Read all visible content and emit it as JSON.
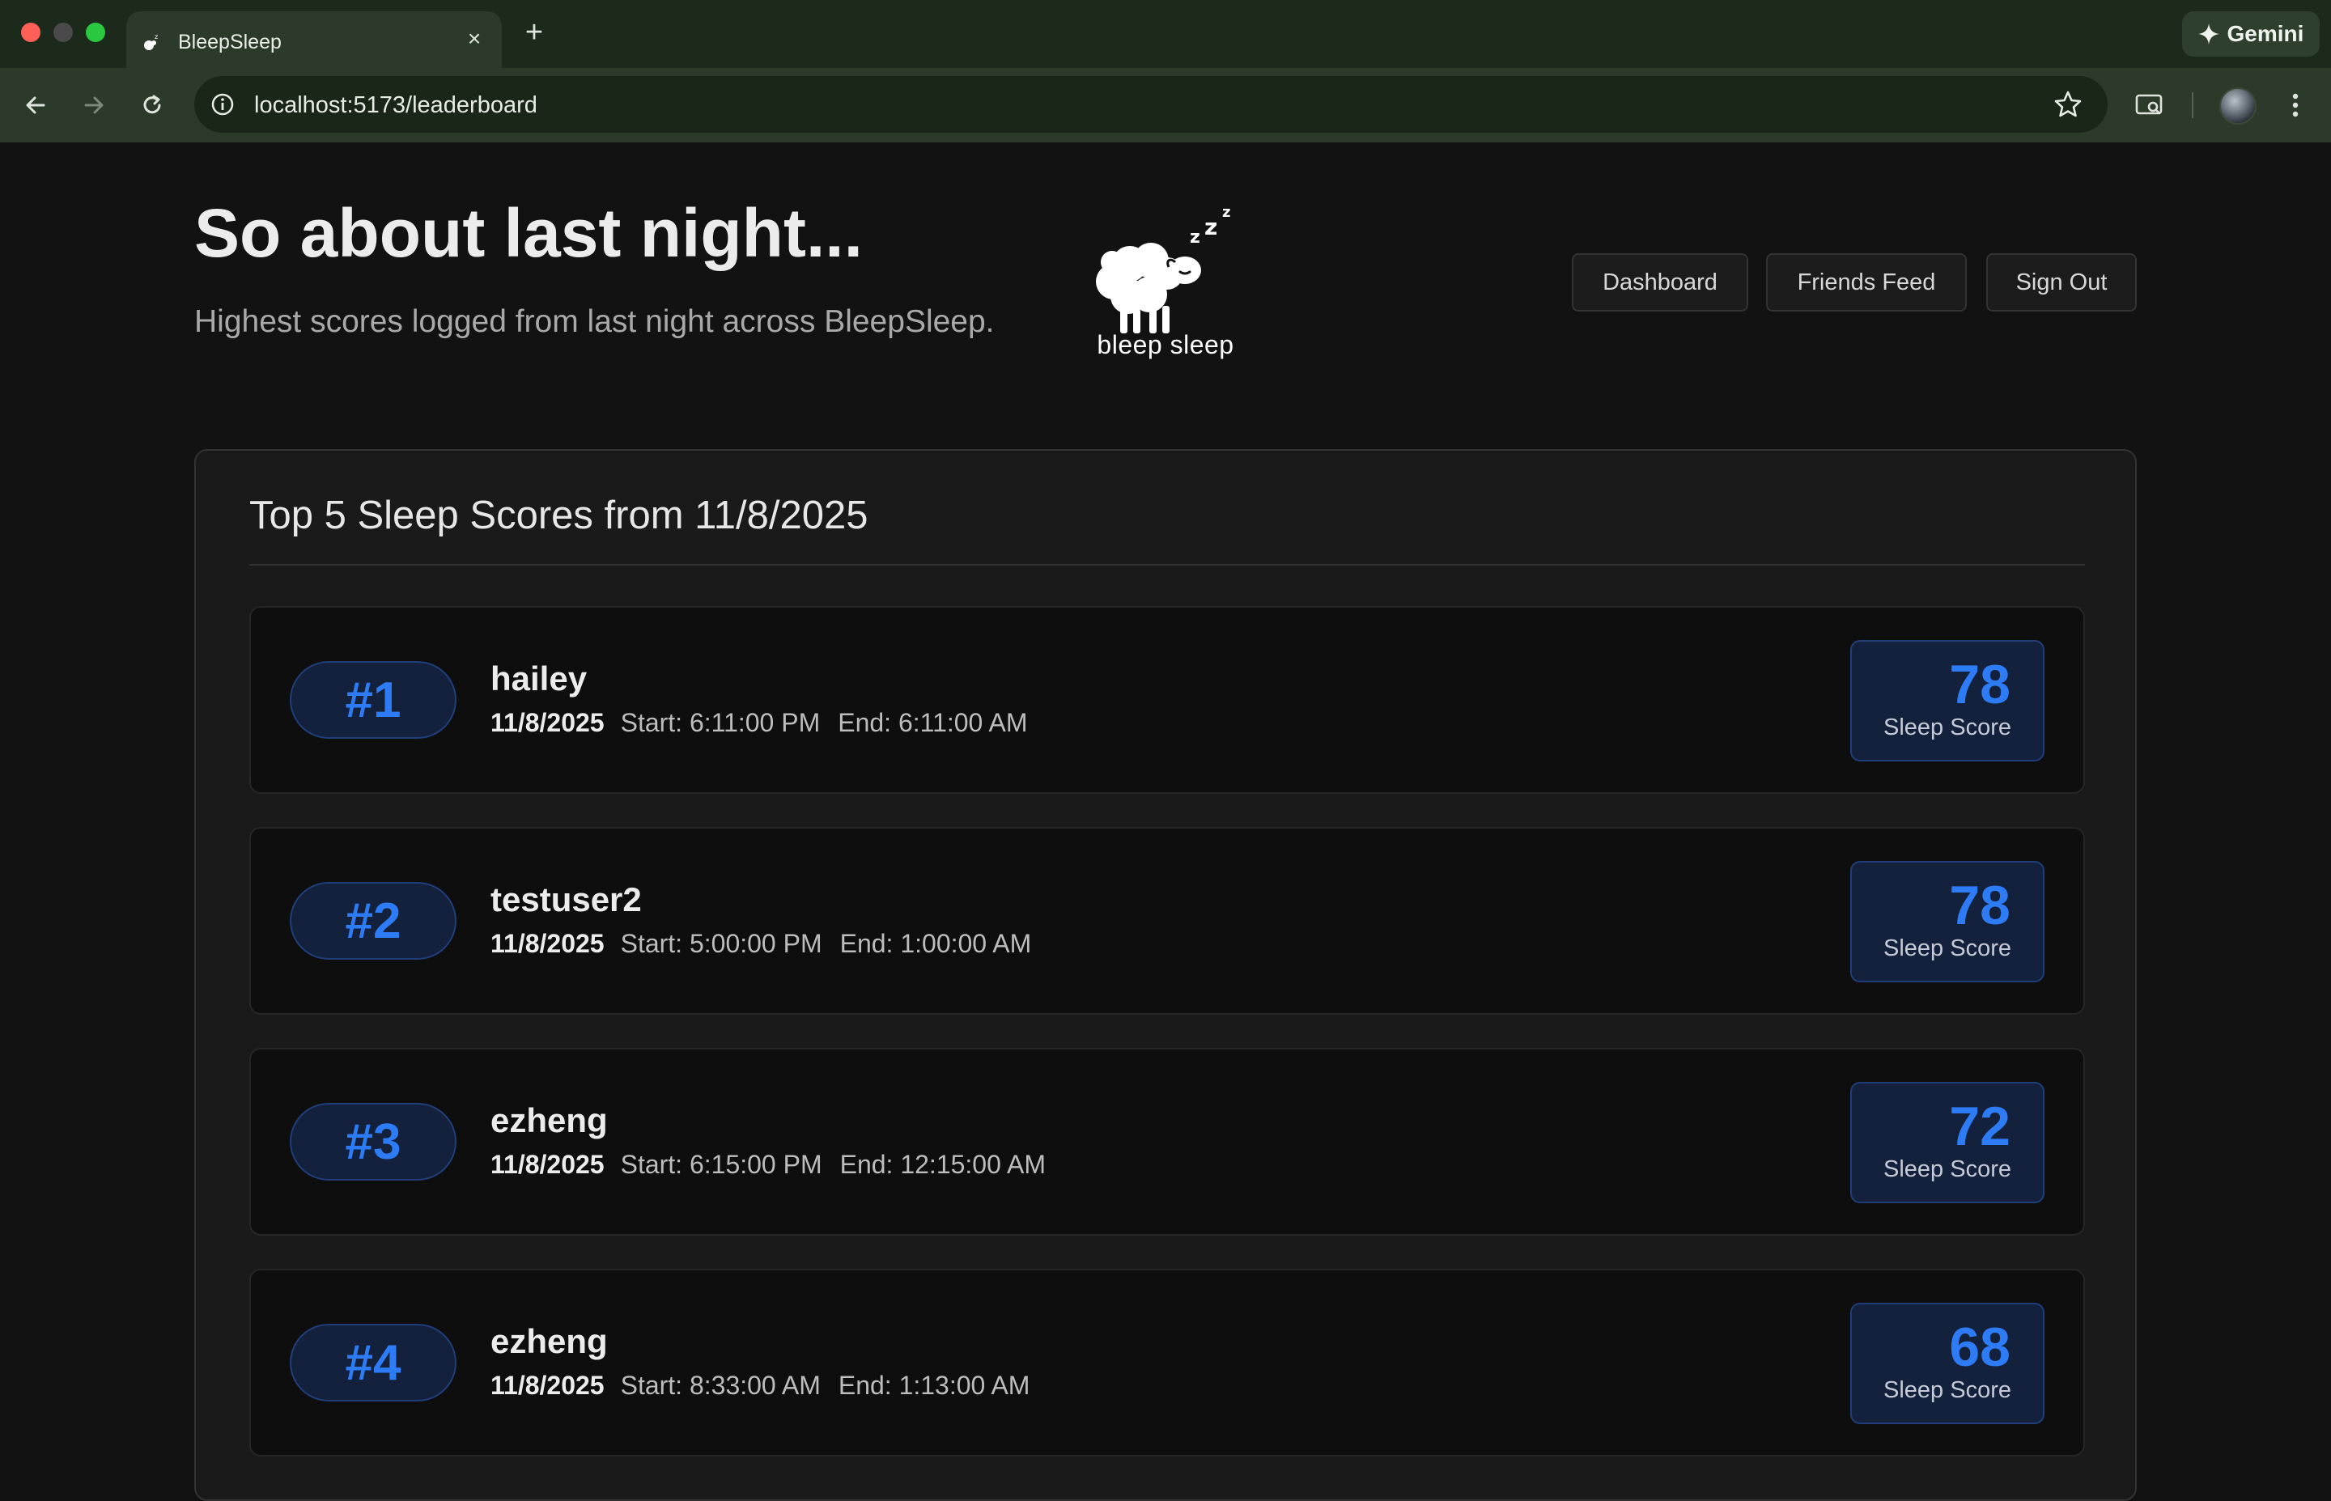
{
  "browser": {
    "tab_title": "BleepSleep",
    "url": "localhost:5173/leaderboard",
    "gemini_label": "Gemini",
    "colors": {
      "tabbar": "#1b2a1a",
      "toolbar": "#2b3a29"
    }
  },
  "header": {
    "title": "So about last night...",
    "subtitle": "Highest scores logged from last night across BleepSleep.",
    "logo_text": "bleep sleep"
  },
  "nav": {
    "dashboard": "Dashboard",
    "friends_feed": "Friends Feed",
    "sign_out": "Sign Out"
  },
  "leaderboard": {
    "title": "Top 5 Sleep Scores from 11/8/2025",
    "score_label": "Sleep Score",
    "accent_color": "#2d7cf6",
    "entries": [
      {
        "rank": "#1",
        "name": "hailey",
        "date": "11/8/2025",
        "start": "Start: 6:11:00 PM",
        "end": "End: 6:11:00 AM",
        "score": "78"
      },
      {
        "rank": "#2",
        "name": "testuser2",
        "date": "11/8/2025",
        "start": "Start: 5:00:00 PM",
        "end": "End: 1:00:00 AM",
        "score": "78"
      },
      {
        "rank": "#3",
        "name": "ezheng",
        "date": "11/8/2025",
        "start": "Start: 6:15:00 PM",
        "end": "End: 12:15:00 AM",
        "score": "72"
      },
      {
        "rank": "#4",
        "name": "ezheng",
        "date": "11/8/2025",
        "start": "Start: 8:33:00 AM",
        "end": "End: 1:13:00 AM",
        "score": "68"
      }
    ]
  },
  "icons": {
    "back": "arrow-left-icon",
    "forward": "arrow-right-icon",
    "reload": "reload-icon",
    "site_info": "info-icon",
    "bookmark": "star-icon",
    "lens": "search-tab-icon",
    "menu": "kebab-menu-icon"
  }
}
